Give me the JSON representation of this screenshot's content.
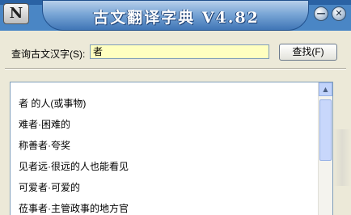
{
  "titlebar": {
    "title": "古文翻译字典 V4.82",
    "logo_letter": "N",
    "minimize_glyph": "—",
    "close_glyph": "✕"
  },
  "search": {
    "label": "查询古文汉字(S):",
    "value": "者",
    "button_label": "查找(F)"
  },
  "results": [
    "者 的人(或事物)",
    "难者·困难的",
    "称善者·夸奖",
    "见者远·很远的人也能看见",
    "可爱者·可爱的",
    "莅事者·主管政事的地方官"
  ],
  "icons": {
    "scroll_up": "▲"
  }
}
